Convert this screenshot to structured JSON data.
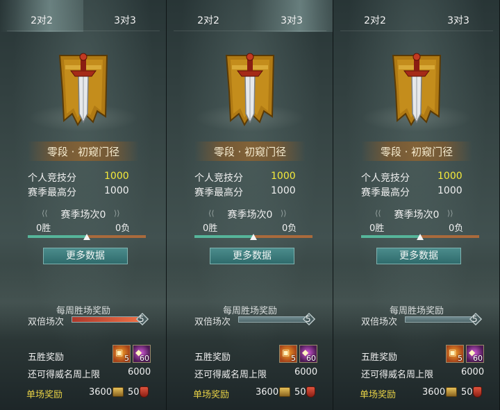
{
  "panels": [
    {
      "tabs": [
        "2对2",
        "3对3"
      ],
      "selected_tab": 0,
      "rank_title": "零段 · 初窥门径",
      "stats": [
        {
          "label": "个人竞技分",
          "value": "1000"
        },
        {
          "label": "赛季最高分",
          "value": "1000"
        }
      ],
      "season_title": "赛季场次0",
      "wins": "0胜",
      "losses": "0负",
      "win_ratio": 0.5,
      "more_button": "更多数据",
      "weekly_title": "每周胜场奖励",
      "double_label": "双倍场次",
      "weekly_progress": 1.0,
      "weekly_count": "5",
      "five_win_label": "五胜奖励",
      "rewards": [
        {
          "icon": "gold-chest-icon",
          "count": "5"
        },
        {
          "icon": "purple-gem-icon",
          "count": "60"
        }
      ],
      "cap_label": "还可得威名周上限",
      "cap_value": "6000",
      "single_label": "单场奖励",
      "single_coin": "3600",
      "single_honor": "50"
    },
    {
      "tabs": [
        "2对2",
        "3对3"
      ],
      "selected_tab": 1,
      "rank_title": "零段 · 初窥门径",
      "stats": [
        {
          "label": "个人竞技分",
          "value": "1000"
        },
        {
          "label": "赛季最高分",
          "value": "1000"
        }
      ],
      "season_title": "赛季场次0",
      "wins": "0胜",
      "losses": "0负",
      "win_ratio": 0.5,
      "more_button": "更多数据",
      "weekly_title": "每周胜场奖励",
      "double_label": "双倍场次",
      "weekly_progress": 0.0,
      "weekly_count": "5",
      "five_win_label": "五胜奖励",
      "rewards": [
        {
          "icon": "gold-chest-icon",
          "count": "5"
        },
        {
          "icon": "purple-gem-icon",
          "count": "60"
        }
      ],
      "cap_label": "还可得威名周上限",
      "cap_value": "6000",
      "single_label": "单场奖励",
      "single_coin": "3600",
      "single_honor": "50"
    },
    {
      "tabs": [
        "2对2",
        "3对3"
      ],
      "selected_tab": -1,
      "rank_title": "零段 · 初窥门径",
      "stats": [
        {
          "label": "个人竞技分",
          "value": "1000"
        },
        {
          "label": "赛季最高分",
          "value": "1000"
        }
      ],
      "season_title": "赛季场次0",
      "wins": "0胜",
      "losses": "0负",
      "win_ratio": 0.5,
      "more_button": "更多数据",
      "weekly_title": "每周胜场奖励",
      "double_label": "双倍场次",
      "weekly_progress": 0.0,
      "weekly_count": "5",
      "five_win_label": "五胜奖励",
      "rewards": [
        {
          "icon": "gold-chest-icon",
          "count": "5"
        },
        {
          "icon": "purple-gem-icon",
          "count": "60"
        }
      ],
      "cap_label": "还可得威名周上限",
      "cap_value": "6000",
      "single_label": "单场奖励",
      "single_coin": "3600",
      "single_honor": "50"
    }
  ],
  "colors": {
    "score_highlight": "#f5ea3a",
    "single_reward_label": "#e7d146",
    "win_bar": "#56b59a",
    "loss_bar": "#a96a3c",
    "button": "#2f6b6c"
  }
}
